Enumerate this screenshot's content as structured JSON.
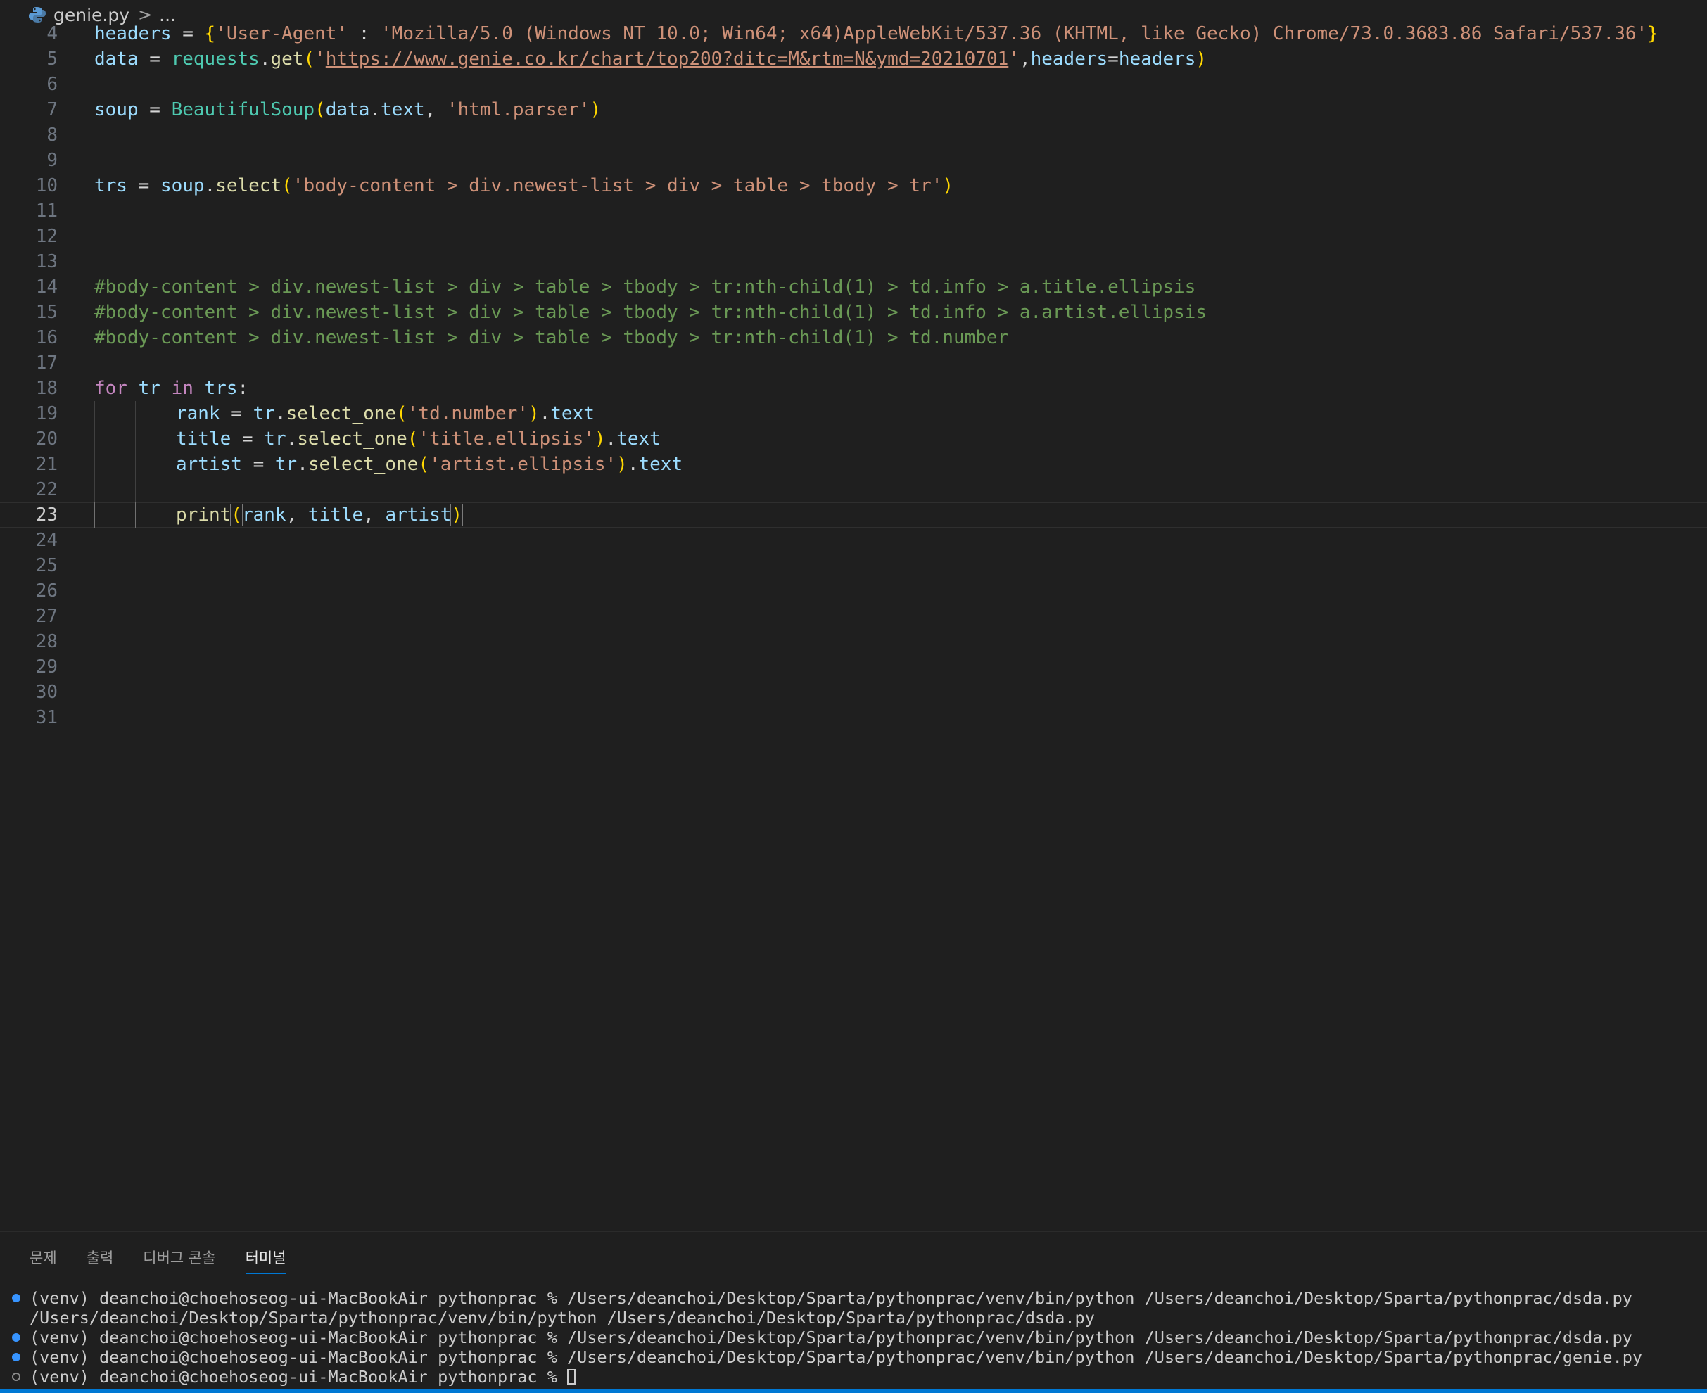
{
  "breadcrumb": {
    "file": "genie.py",
    "separator": ">",
    "rest": "..."
  },
  "editor": {
    "current_line": 23,
    "lines": [
      {
        "n": "4",
        "tokens": [
          [
            "var",
            "headers"
          ],
          [
            "op",
            " = "
          ],
          [
            "br1",
            "{"
          ],
          [
            "str",
            "'User-Agent'"
          ],
          [
            "op",
            " : "
          ],
          [
            "str",
            "'Mozilla/5.0 (Windows NT 10.0; Win64; x64)AppleWebKit/537.36 (KHTML, like Gecko) Chrome/73.0.3683.86 Safari/537.36'"
          ],
          [
            "br1",
            "}"
          ]
        ]
      },
      {
        "n": "5",
        "tokens": [
          [
            "var",
            "data"
          ],
          [
            "op",
            " = "
          ],
          [
            "cls",
            "requests"
          ],
          [
            "op",
            "."
          ],
          [
            "fn",
            "get"
          ],
          [
            "br1",
            "("
          ],
          [
            "str",
            "'"
          ],
          [
            "url",
            "https://www.genie.co.kr/chart/top200?ditc=M&rtm=N&ymd=20210701"
          ],
          [
            "str",
            "'"
          ],
          [
            "op",
            ","
          ],
          [
            "var",
            "headers"
          ],
          [
            "op",
            "="
          ],
          [
            "var",
            "headers"
          ],
          [
            "br1",
            ")"
          ]
        ]
      },
      {
        "n": "6",
        "tokens": []
      },
      {
        "n": "7",
        "tokens": [
          [
            "var",
            "soup"
          ],
          [
            "op",
            " = "
          ],
          [
            "cls",
            "BeautifulSoup"
          ],
          [
            "br1",
            "("
          ],
          [
            "var",
            "data"
          ],
          [
            "op",
            "."
          ],
          [
            "var",
            "text"
          ],
          [
            "op",
            ", "
          ],
          [
            "str",
            "'html.parser'"
          ],
          [
            "br1",
            ")"
          ]
        ]
      },
      {
        "n": "8",
        "tokens": []
      },
      {
        "n": "9",
        "tokens": []
      },
      {
        "n": "10",
        "tokens": [
          [
            "var",
            "trs"
          ],
          [
            "op",
            " = "
          ],
          [
            "var",
            "soup"
          ],
          [
            "op",
            "."
          ],
          [
            "fn",
            "select"
          ],
          [
            "br1",
            "("
          ],
          [
            "str",
            "'body-content > div.newest-list > div > table > tbody > tr'"
          ],
          [
            "br1",
            ")"
          ]
        ]
      },
      {
        "n": "11",
        "tokens": []
      },
      {
        "n": "12",
        "tokens": []
      },
      {
        "n": "13",
        "tokens": []
      },
      {
        "n": "14",
        "tokens": [
          [
            "cmt",
            "#body-content > div.newest-list > div > table > tbody > tr:nth-child(1) > td.info > a.title.ellipsis"
          ]
        ]
      },
      {
        "n": "15",
        "tokens": [
          [
            "cmt",
            "#body-content > div.newest-list > div > table > tbody > tr:nth-child(1) > td.info > a.artist.ellipsis"
          ]
        ]
      },
      {
        "n": "16",
        "tokens": [
          [
            "cmt",
            "#body-content > div.newest-list > div > table > tbody > tr:nth-child(1) > td.number"
          ]
        ]
      },
      {
        "n": "17",
        "tokens": []
      },
      {
        "n": "18",
        "tokens": [
          [
            "kw",
            "for"
          ],
          [
            "op",
            " "
          ],
          [
            "var",
            "tr"
          ],
          [
            "op",
            " "
          ],
          [
            "kw",
            "in"
          ],
          [
            "op",
            " "
          ],
          [
            "var",
            "trs"
          ],
          [
            "op",
            ":"
          ]
        ]
      },
      {
        "n": "19",
        "indent": 1,
        "tokens": [
          [
            "var",
            "rank"
          ],
          [
            "op",
            " = "
          ],
          [
            "var",
            "tr"
          ],
          [
            "op",
            "."
          ],
          [
            "fn",
            "select_one"
          ],
          [
            "br1",
            "("
          ],
          [
            "str",
            "'td.number'"
          ],
          [
            "br1",
            ")"
          ],
          [
            "op",
            "."
          ],
          [
            "var",
            "text"
          ]
        ]
      },
      {
        "n": "20",
        "indent": 1,
        "tokens": [
          [
            "var",
            "title"
          ],
          [
            "op",
            " = "
          ],
          [
            "var",
            "tr"
          ],
          [
            "op",
            "."
          ],
          [
            "fn",
            "select_one"
          ],
          [
            "br1",
            "("
          ],
          [
            "str",
            "'title.ellipsis'"
          ],
          [
            "br1",
            ")"
          ],
          [
            "op",
            "."
          ],
          [
            "var",
            "text"
          ]
        ]
      },
      {
        "n": "21",
        "indent": 1,
        "tokens": [
          [
            "var",
            "artist"
          ],
          [
            "op",
            " = "
          ],
          [
            "var",
            "tr"
          ],
          [
            "op",
            "."
          ],
          [
            "fn",
            "select_one"
          ],
          [
            "br1",
            "("
          ],
          [
            "str",
            "'artist.ellipsis'"
          ],
          [
            "br1",
            ")"
          ],
          [
            "op",
            "."
          ],
          [
            "var",
            "text"
          ]
        ]
      },
      {
        "n": "22",
        "indent": 1,
        "tokens": []
      },
      {
        "n": "23",
        "indent": 1,
        "tokens": [
          [
            "fn",
            "print"
          ],
          [
            "br1 brm",
            "("
          ],
          [
            "var",
            "rank"
          ],
          [
            "op",
            ", "
          ],
          [
            "var",
            "title"
          ],
          [
            "op",
            ", "
          ],
          [
            "var",
            "artist"
          ],
          [
            "br1 brm",
            ")"
          ]
        ]
      },
      {
        "n": "24",
        "tokens": []
      },
      {
        "n": "25",
        "tokens": []
      },
      {
        "n": "26",
        "tokens": []
      },
      {
        "n": "27",
        "tokens": []
      },
      {
        "n": "28",
        "tokens": []
      },
      {
        "n": "29",
        "tokens": []
      },
      {
        "n": "30",
        "tokens": []
      },
      {
        "n": "31",
        "tokens": []
      }
    ]
  },
  "panel": {
    "tabs": [
      {
        "label": "문제",
        "active": false
      },
      {
        "label": "출력",
        "active": false
      },
      {
        "label": "디버그 콘솔",
        "active": false
      },
      {
        "label": "터미널",
        "active": true
      }
    ],
    "terminal": [
      {
        "dot": "filled",
        "text": "(venv) deanchoi@choehoseog-ui-MacBookAir pythonprac % /Users/deanchoi/Desktop/Sparta/pythonprac/venv/bin/python /Users/deanchoi/Desktop/Sparta/pythonprac/dsda.py"
      },
      {
        "dot": "none",
        "text": "/Users/deanchoi/Desktop/Sparta/pythonprac/venv/bin/python /Users/deanchoi/Desktop/Sparta/pythonprac/dsda.py"
      },
      {
        "dot": "filled",
        "text": "(venv) deanchoi@choehoseog-ui-MacBookAir pythonprac % /Users/deanchoi/Desktop/Sparta/pythonprac/venv/bin/python /Users/deanchoi/Desktop/Sparta/pythonprac/dsda.py"
      },
      {
        "dot": "filled",
        "text": "(venv) deanchoi@choehoseog-ui-MacBookAir pythonprac % /Users/deanchoi/Desktop/Sparta/pythonprac/venv/bin/python /Users/deanchoi/Desktop/Sparta/pythonprac/genie.py"
      },
      {
        "dot": "hollow",
        "text": "(venv) deanchoi@choehoseog-ui-MacBookAir pythonprac % ",
        "cursor": true
      }
    ]
  },
  "colors": {
    "accent": "#0078d4",
    "background": "#1f1f1f",
    "decoration_dot": "#3794ff"
  }
}
